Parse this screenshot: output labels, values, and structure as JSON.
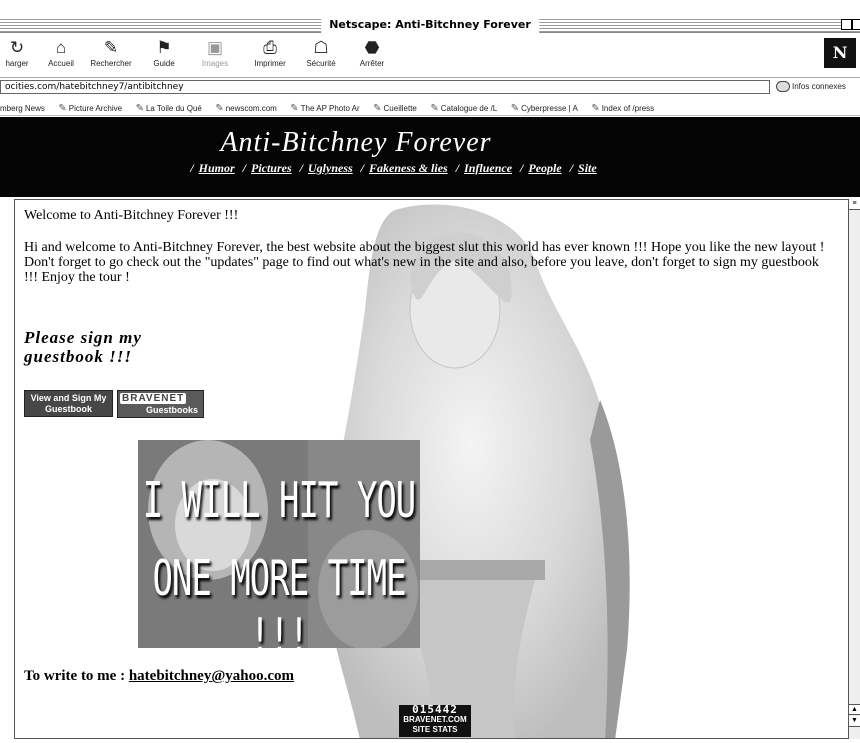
{
  "window": {
    "title": "Netscape: Anti-Bitchney Forever"
  },
  "toolbar": {
    "buttons": [
      {
        "label": "harger",
        "icon": "reload-icon",
        "disabled": false
      },
      {
        "label": "Accueil",
        "icon": "home-icon",
        "disabled": false
      },
      {
        "label": "Rechercher",
        "icon": "search-icon",
        "disabled": false
      },
      {
        "label": "Guide",
        "icon": "guide-icon",
        "disabled": false
      },
      {
        "label": "Images",
        "icon": "images-icon",
        "disabled": true
      },
      {
        "label": "Imprimer",
        "icon": "print-icon",
        "disabled": false
      },
      {
        "label": "Sécurité",
        "icon": "lock-icon",
        "disabled": false
      },
      {
        "label": "Arrêter",
        "icon": "stop-icon",
        "disabled": false
      }
    ]
  },
  "location": {
    "url": "ocities.com/hatebitchney7/antibitchney",
    "related_label": "Infos connexes"
  },
  "personal_toolbar": {
    "items": [
      "mberg News",
      "Picture Archive",
      "La Toile du Qué",
      "newscom.com",
      "The AP Photo Ar",
      "Cueillette",
      "Catalogue de /L",
      "Cyberpresse | A",
      "Index of /press"
    ]
  },
  "site": {
    "title": "Anti-Bitchney Forever",
    "nav": [
      "Humor",
      "Pictures",
      "Uglyness",
      "Fakeness & lies",
      "Influence",
      "People",
      "Site"
    ]
  },
  "main": {
    "welcome_line": "Welcome to Anti-Bitchney Forever !!!",
    "welcome_paragraph": "Hi and welcome to Anti-Bitchney Forever, the best website about the biggest slut this world has ever known !!! Hope you like the new layout ! Don't forget to go check out the \"updates\" page to find out what's new in the site and also, before you leave, don't forget to sign my guestbook !!! Enjoy the tour !",
    "guestbook_heading": "Please sign my guestbook !!!",
    "guestbook_button": "View and Sign My Guestbook",
    "bravenet_brand": "BRAVENET",
    "bravenet_sub": "Guestbooks",
    "image_caption_line1": "I WILL HIT YOU",
    "image_caption_line2": "ONE MORE TIME !!!",
    "write_label": "To write to me :",
    "email": "hatebitchney@yahoo.com"
  },
  "counter": {
    "value": "015442",
    "brand": "BRAVENET.COM",
    "stats": "SITE STATS"
  }
}
